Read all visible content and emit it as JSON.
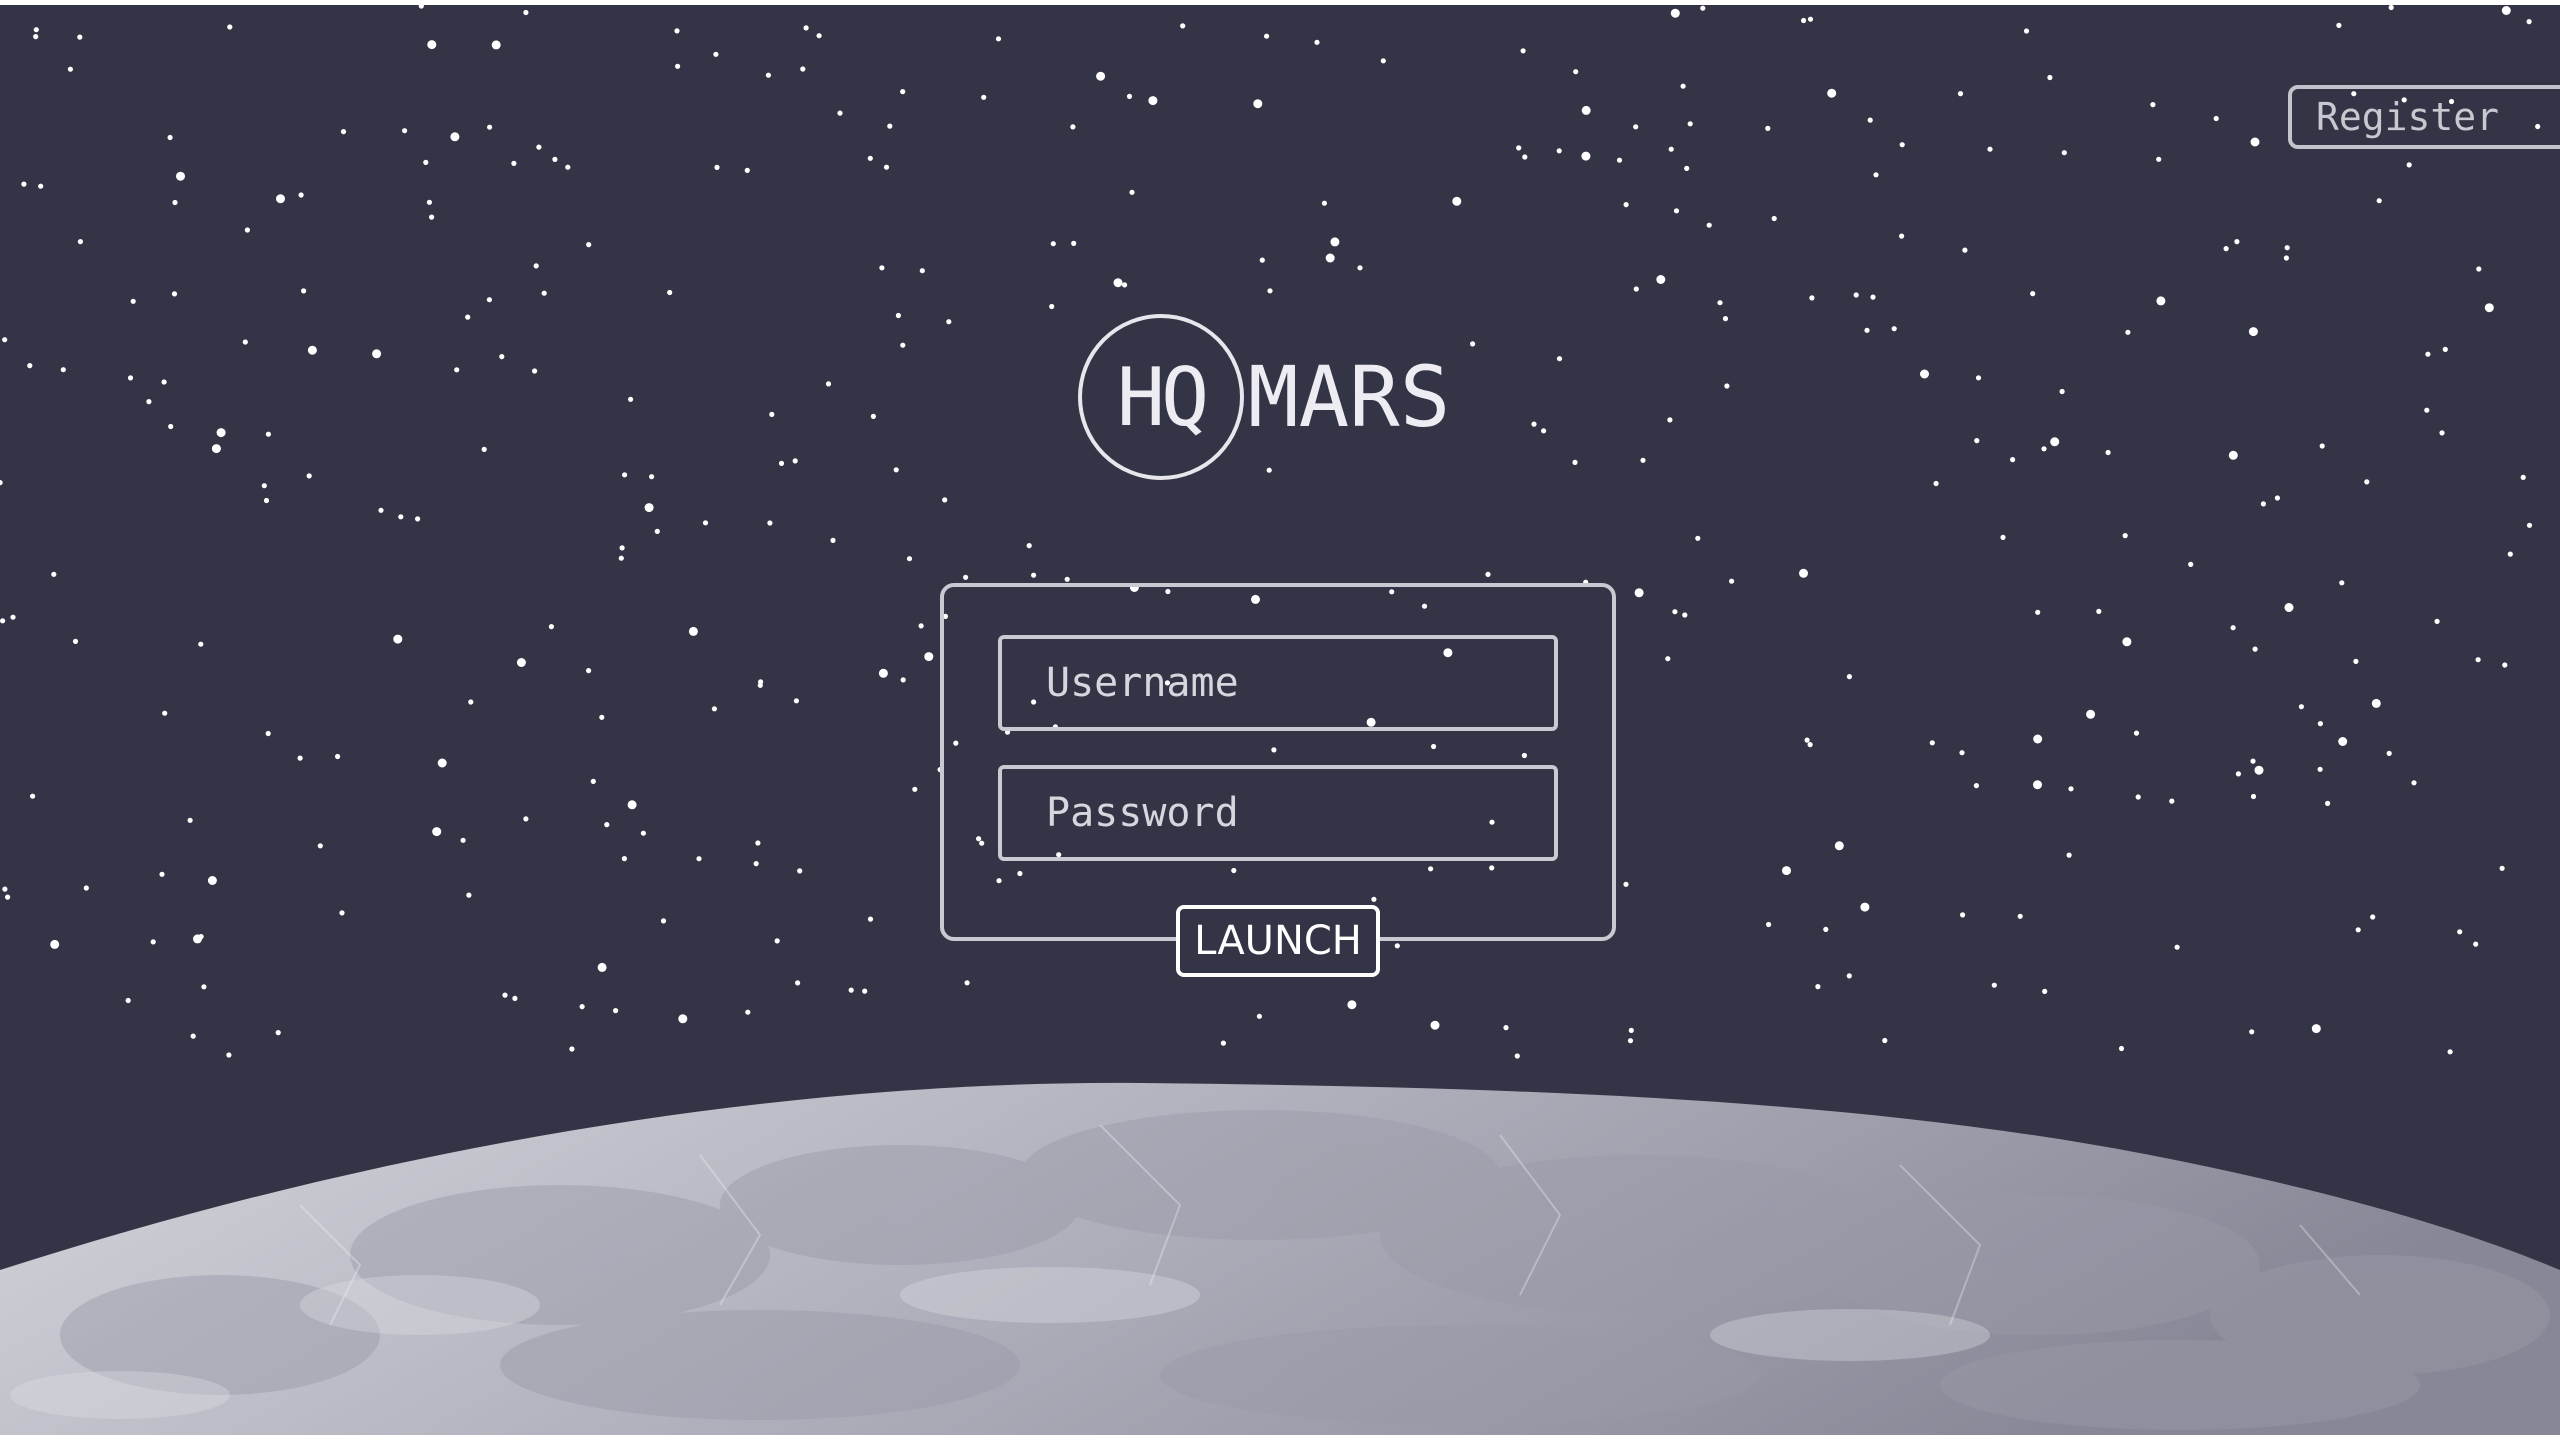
{
  "header": {
    "register_label": "Register"
  },
  "logo": {
    "circle_text": "HQ",
    "wordmark": "MARS"
  },
  "login": {
    "username_placeholder": "Username",
    "password_placeholder": "Password",
    "launch_label": "LAUNCH"
  },
  "colors": {
    "space_background": "#333446",
    "moon_light": "#cfcfd6",
    "moon_dark": "#8e8e9c",
    "outline": "#c9c9d2",
    "text": "#ececf2"
  }
}
